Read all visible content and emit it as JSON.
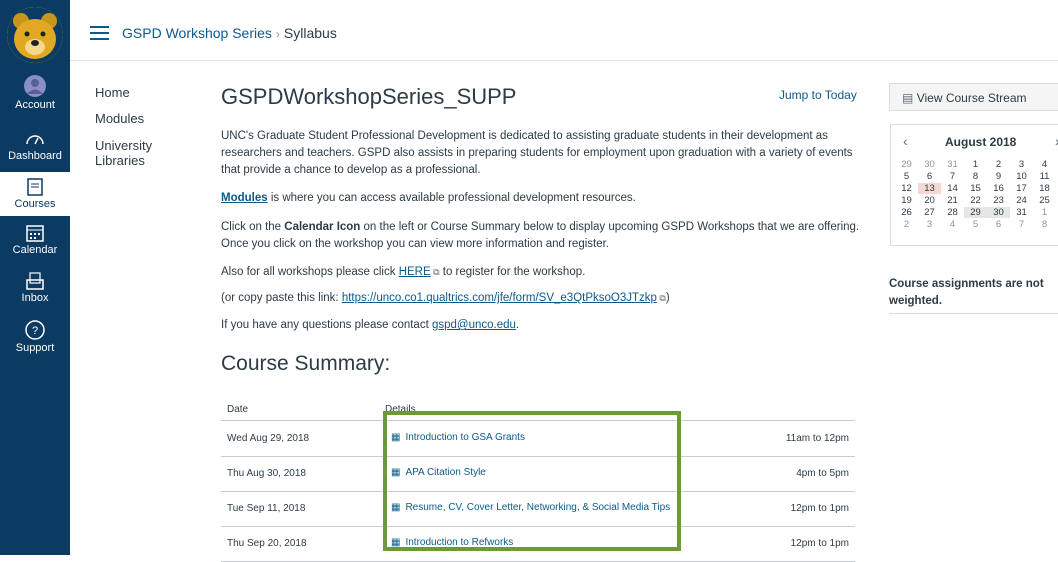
{
  "global_nav": {
    "account": "Account",
    "dashboard": "Dashboard",
    "courses": "Courses",
    "calendar": "Calendar",
    "inbox": "Inbox",
    "support": "Support"
  },
  "header": {
    "course_crumb": "GSPD Workshop Series",
    "page_crumb": "Syllabus"
  },
  "course_nav": [
    "Home",
    "Modules",
    "University Libraries"
  ],
  "main": {
    "title": "GSPDWorkshopSeries_SUPP",
    "jump": "Jump to Today",
    "intro": "UNC's Graduate Student Professional Development is dedicated to assisting graduate students in their development as researchers and teachers. GSPD also assists in preparing students for employment upon graduation with a variety of events that provide a chance to develop as a professional.",
    "modules_link": "Modules",
    "modules_rest": " is where you can access available professional development resources.",
    "calendar_pre": "Click on the ",
    "calendar_bold": "Calendar Icon",
    "calendar_rest": " on the left or Course Summary below to display upcoming GSPD Workshops that we are offering.  Once you click on the workshop you can view more information and register.",
    "here_pre": "Also for all workshops please click ",
    "here_link": "HERE",
    "here_rest": " to register for the workshop.",
    "copy_pre": "(or copy paste this link: ",
    "copy_link": "https://unco.co1.qualtrics.com/jfe/form/SV_e3QtPksoO3JTzkp",
    "copy_post": ")",
    "contact_pre": "If you have any questions please contact ",
    "contact_link": "gspd@unco.edu",
    "contact_post": ".",
    "summary_title": "Course Summary:",
    "col_date": "Date",
    "col_details": "Details",
    "rows": [
      {
        "date": "Wed Aug 29, 2018",
        "title": "Introduction to GSA Grants",
        "time": "11am to 12pm"
      },
      {
        "date": "Thu Aug 30, 2018",
        "title": "APA Citation Style",
        "time": "4pm to 5pm"
      },
      {
        "date": "Tue Sep 11, 2018",
        "title": "Resume, CV, Cover Letter, Networking, & Social Media Tips",
        "time": "12pm to 1pm"
      },
      {
        "date": "Thu Sep 20, 2018",
        "title": "Introduction to Refworks",
        "time": "12pm to 1pm"
      }
    ]
  },
  "sidebar": {
    "stream": "View Course Stream",
    "month": "August 2018",
    "days": [
      "29",
      "30",
      "31",
      "1",
      "2",
      "3",
      "4",
      "5",
      "6",
      "7",
      "8",
      "9",
      "10",
      "11",
      "12",
      "13",
      "14",
      "15",
      "16",
      "17",
      "18",
      "19",
      "20",
      "21",
      "22",
      "23",
      "24",
      "25",
      "26",
      "27",
      "28",
      "29",
      "30",
      "31",
      "1",
      "2",
      "3",
      "4",
      "5",
      "6",
      "7",
      "8"
    ],
    "note": "Course assignments are not weighted."
  },
  "colors": {
    "nav_bg": "#0b3a63",
    "link": "#0b5a8a",
    "highlight": "#6c9a3a"
  }
}
